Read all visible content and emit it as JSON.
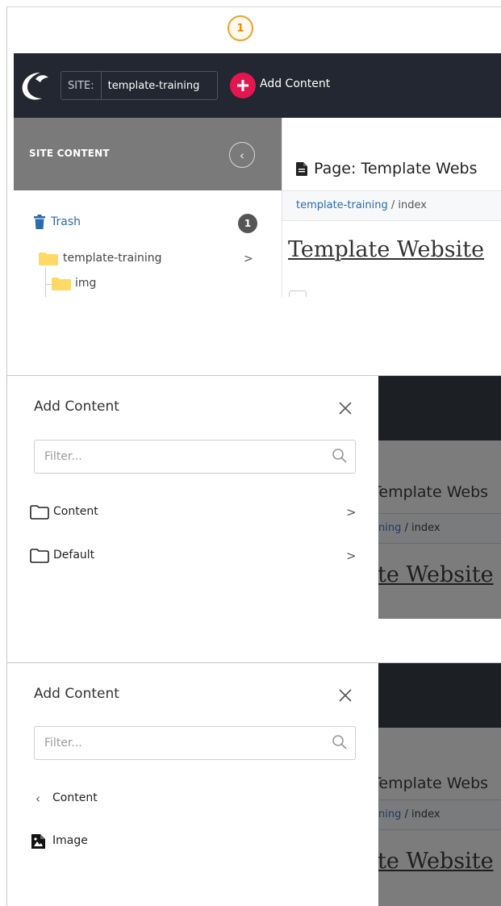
{
  "step": {
    "number": "1"
  },
  "topbar": {
    "site_label": "SITE:",
    "site_value": "template-training",
    "add_content_label": "Add Content"
  },
  "sidebar": {
    "title": "SITE CONTENT",
    "trash_label": "Trash",
    "trash_count": "1",
    "tree": [
      {
        "label": "template-training",
        "chevron": ">"
      },
      {
        "label": "img"
      }
    ]
  },
  "main": {
    "page_title": "Page: Template Webs",
    "breadcrumb_link": "template-training",
    "breadcrumb_rest": " / index",
    "page_heading": "Template Website"
  },
  "panel1": {
    "title": "Add Content",
    "filter_placeholder": "Filter...",
    "items": [
      {
        "label": "Content",
        "chevron": ">"
      },
      {
        "label": "Default",
        "chevron": ">"
      }
    ]
  },
  "panel2": {
    "title": "Add Content",
    "filter_placeholder": "Filter...",
    "back_label": "Content",
    "items": [
      {
        "label": "Image"
      }
    ]
  },
  "background_preview": {
    "title": "Template Webs",
    "breadcrumb_link": "ning",
    "breadcrumb_rest": " / index",
    "heading": "te Website"
  },
  "colors": {
    "topbar": "#222731",
    "accent_add": "#e3164f",
    "link": "#2a6ab0",
    "folder": "#ffd966",
    "badge": "#f0a030"
  }
}
